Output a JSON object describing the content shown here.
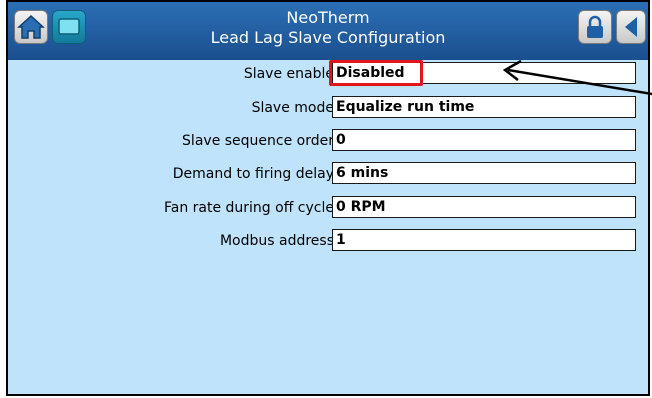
{
  "header": {
    "title_line1": "NeoTherm",
    "title_line2": "Lead Lag Slave Configuration"
  },
  "icons": {
    "home": "home-icon",
    "display": "display-icon",
    "lock": "lock-icon",
    "back": "back-arrow-icon"
  },
  "settings": [
    {
      "label": "Slave enable",
      "value": "Disabled"
    },
    {
      "label": "Slave mode",
      "value": "Equalize run time"
    },
    {
      "label": "Slave sequence order",
      "value": "0"
    },
    {
      "label": "Demand to firing delay",
      "value": "6 mins"
    },
    {
      "label": "Fan rate during off cycle",
      "value": "0 RPM"
    },
    {
      "label": "Modbus address",
      "value": "1"
    }
  ],
  "colors": {
    "header_blue": "#1f5fa6",
    "panel_bg": "#bfe3fb",
    "highlight_red": "#e3151a"
  }
}
